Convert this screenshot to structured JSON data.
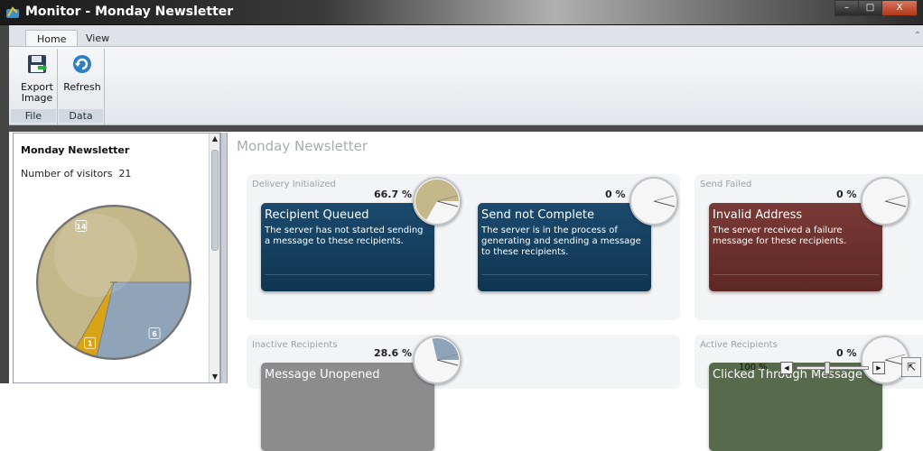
{
  "window": {
    "title": "Monitor - Monday Newsletter",
    "minimize": "–",
    "maximize": "□",
    "close": "X"
  },
  "ribbon_tabs": [
    {
      "label": "Home"
    },
    {
      "label": "View"
    }
  ],
  "ribbon": {
    "export_label_1": "Export",
    "export_label_2": "Image",
    "refresh_label": "Refresh",
    "group_file": "File",
    "group_data": "Data"
  },
  "left_panel": {
    "title": "Monday Newsletter",
    "visitors_label": "Number of visitors",
    "visitors_count": "21",
    "pie": {
      "slices": [
        {
          "label": "14",
          "value": 14,
          "color": "#c4b88a"
        },
        {
          "label": "1",
          "value": 1,
          "color": "#d9a318"
        },
        {
          "label": "6",
          "value": 6,
          "color": "#8fa4b8"
        }
      ]
    }
  },
  "main": {
    "title": "Monday Newsletter",
    "sections": {
      "delivery": {
        "label": "Delivery Initialized"
      },
      "send_failed": {
        "label": "Send Failed"
      },
      "inactive": {
        "label": "Inactive Recipients"
      },
      "active": {
        "label": "Active Recipients"
      }
    },
    "cards": {
      "recipient_queued": {
        "pct": "66.7 %",
        "fraction": 0.667,
        "title": "Recipient Queued",
        "desc": "The server has not started sending a message to these recipients."
      },
      "send_not_complete": {
        "pct": "0 %",
        "fraction": 0,
        "title": "Send not Complete",
        "desc": "The server is in the process of generating and sending a message to these recipients."
      },
      "invalid_address": {
        "pct": "0 %",
        "fraction": 0,
        "title": "Invalid Address",
        "desc": "The server received a failure message for these recipients."
      },
      "message_unopened": {
        "pct": "28.6 %",
        "fraction": 0.286,
        "title": "Message Unopened"
      },
      "clicked_through": {
        "pct": "0 %",
        "fraction": 0,
        "title": "Clicked Through Message"
      }
    },
    "gauge_fill_colors": {
      "queued": "#c4b88a",
      "unopened": "#8fa4b8"
    }
  },
  "zoom": {
    "level": "100 %",
    "left_arrow": "◀",
    "right_arrow": "▶",
    "expand": "⇱"
  }
}
